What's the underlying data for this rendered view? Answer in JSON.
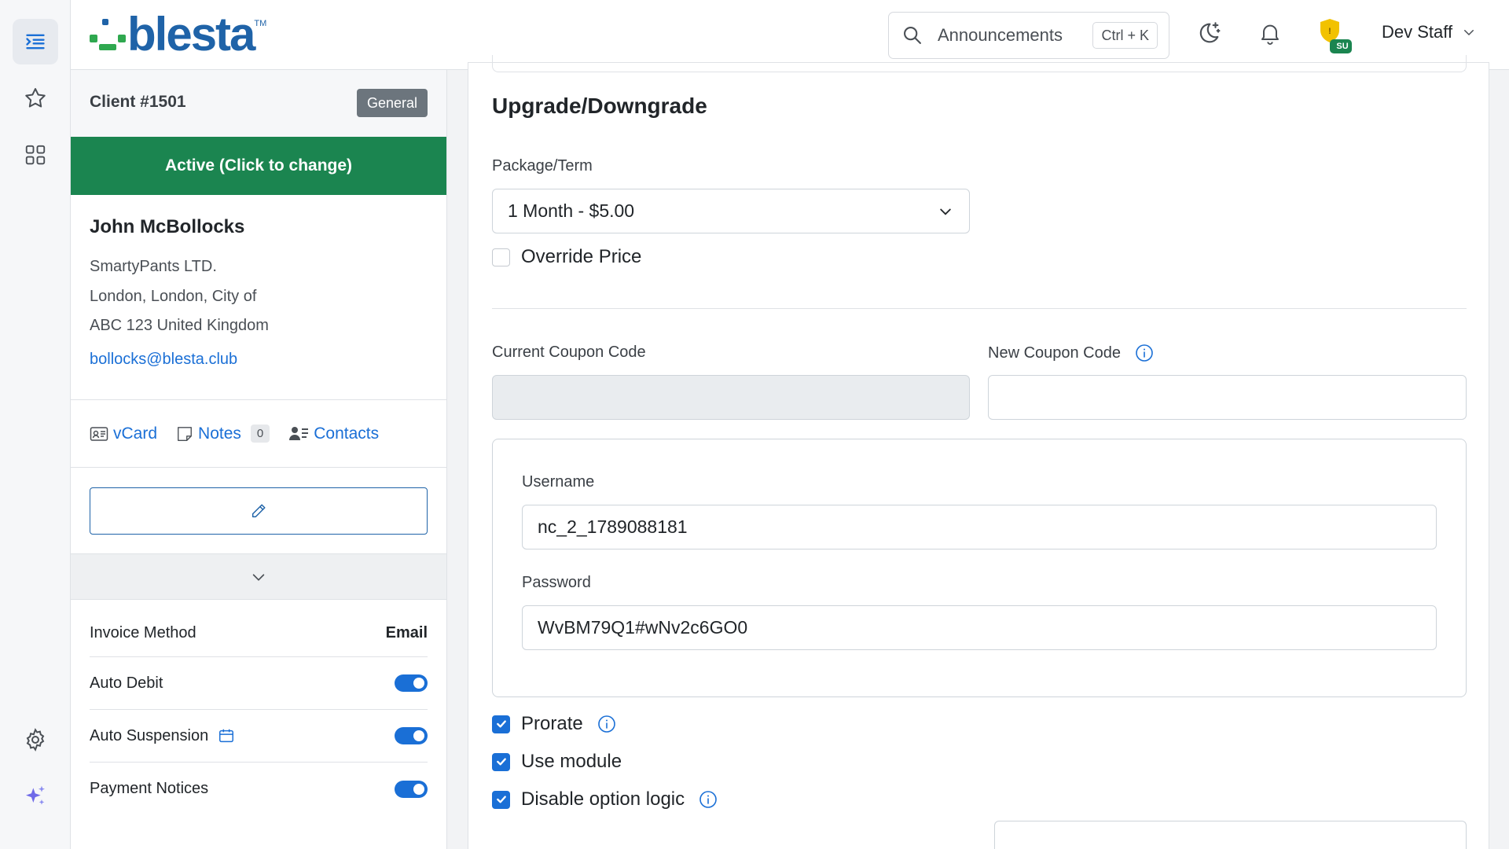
{
  "brand": {
    "logo_text": "blesta",
    "logo_tm": "TM",
    "primary_color": "#1f63a8",
    "success_color": "#1b8550",
    "link_color": "#1a6fd6"
  },
  "header": {
    "search_label": "Announcements",
    "search_shortcut": "Ctrl + K",
    "staff_badge": "SU",
    "user_name": "Dev Staff"
  },
  "rail": {
    "icons": [
      "menu-indent-icon",
      "star-icon",
      "grid-icon",
      "gear-icon",
      "sparkles-icon"
    ]
  },
  "client": {
    "id_label": "Client #1501",
    "group_badge": "General",
    "status_button": "Active (Click to change)",
    "name": "John McBollocks",
    "company": "SmartyPants LTD.",
    "city_line": "London, London, City of",
    "postal_line": "ABC 123 United Kingdom",
    "email": "bollocks@blesta.club",
    "links": {
      "vcard": "vCard",
      "notes": "Notes",
      "notes_count": "0",
      "contacts": "Contacts"
    },
    "settings": {
      "invoice_method_label": "Invoice Method",
      "invoice_method_value": "Email",
      "auto_debit_label": "Auto Debit",
      "auto_debit_on": true,
      "auto_suspension_label": "Auto Suspension",
      "auto_suspension_on": true,
      "payment_notices_label": "Payment Notices",
      "payment_notices_on": true
    }
  },
  "form": {
    "section_title": "Upgrade/Downgrade",
    "package_label": "Package/Term",
    "package_value": "1 Month - $5.00",
    "override_price_label": "Override Price",
    "override_price_checked": false,
    "current_coupon_label": "Current Coupon Code",
    "current_coupon_value": "",
    "new_coupon_label": "New Coupon Code",
    "new_coupon_value": "",
    "username_label": "Username",
    "username_value": "nc_2_1789088181",
    "password_label": "Password",
    "password_value": "WvBM79Q1#wNv2c6GO0",
    "prorate_label": "Prorate",
    "prorate_checked": true,
    "use_module_label": "Use module",
    "use_module_checked": true,
    "disable_option_logic_label": "Disable option logic",
    "disable_option_logic_checked": true
  }
}
